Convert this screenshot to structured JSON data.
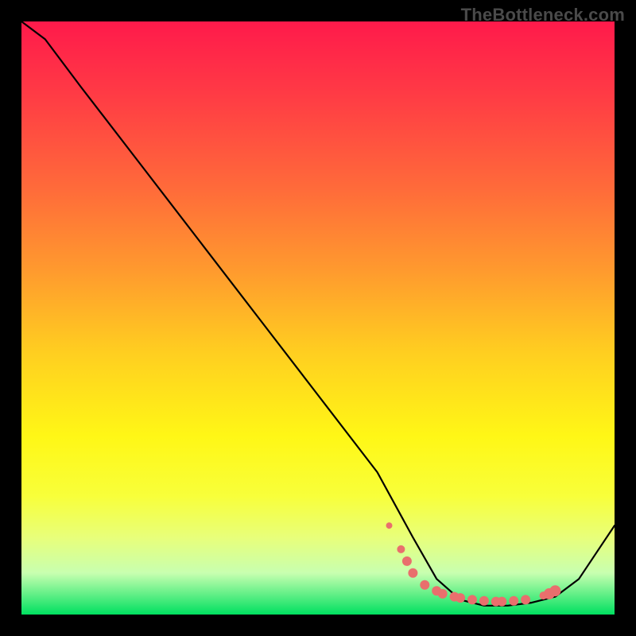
{
  "watermark": "TheBottleneck.com",
  "chart_data": {
    "type": "line",
    "title": "",
    "xlabel": "",
    "ylabel": "",
    "xlim": [
      0,
      100
    ],
    "ylim": [
      0,
      100
    ],
    "series": [
      {
        "name": "bottleneck-curve",
        "x": [
          0,
          4,
          10,
          20,
          30,
          40,
          50,
          60,
          66,
          70,
          74,
          78,
          82,
          86,
          90,
          94,
          100
        ],
        "y": [
          100,
          97,
          89,
          76,
          63,
          50,
          37,
          24,
          13,
          6,
          2.5,
          1.5,
          1.5,
          2.0,
          3.0,
          6,
          15
        ]
      }
    ],
    "markers": {
      "name": "highlight-points",
      "color": "#e96f6d",
      "x": [
        62,
        64,
        65,
        66,
        68,
        70,
        71,
        73,
        74,
        76,
        78,
        80,
        81,
        83,
        85,
        88,
        89,
        90
      ],
      "y": [
        15,
        11,
        9,
        7,
        5,
        4,
        3.5,
        3,
        2.8,
        2.5,
        2.3,
        2.2,
        2.2,
        2.3,
        2.5,
        3.2,
        3.5,
        4.0
      ],
      "r": [
        4,
        5,
        6,
        6,
        6,
        6,
        6,
        6,
        6,
        6,
        6,
        6,
        6,
        6,
        6,
        5,
        7,
        7
      ]
    }
  }
}
